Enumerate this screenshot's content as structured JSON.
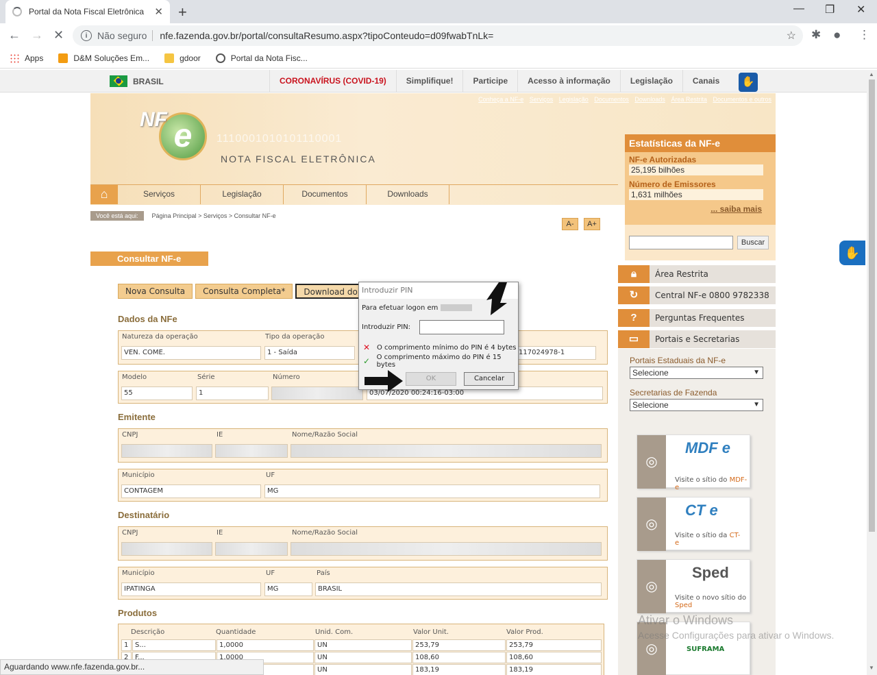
{
  "browser": {
    "tab_title": "Portal da Nota Fiscal Eletrônica",
    "not_secure": "Não seguro",
    "url": "nfe.fazenda.gov.br/portal/consultaResumo.aspx?tipoConteudo=d09fwabTnLk=",
    "bookmarks": [
      "Apps",
      "D&M Soluções Em...",
      "gdoor",
      "Portal da Nota Fisc..."
    ],
    "status": "Aguardando www.nfe.fazenda.gov.br..."
  },
  "govbar": {
    "brasil": "BRASIL",
    "links": [
      "CORONAVÍRUS (COVID-19)",
      "Simplifique!",
      "Participe",
      "Acesso à informação",
      "Legislação",
      "Canais"
    ]
  },
  "site": {
    "toplinks": [
      "Conheça a NF-e",
      "Serviços",
      "Legislação",
      "Documentos",
      "Downloads",
      "Área Restrita",
      "Documentos e outros"
    ],
    "logo_text": "NF",
    "logo_e": "e",
    "binary": "1110001010101110001",
    "tagline": "NOTA FISCAL ELETRÔNICA",
    "nav": [
      "Serviços",
      "Legislação",
      "Documentos",
      "Downloads"
    ],
    "breadcrumb_here": "Você está aqui:",
    "breadcrumb": "Página Principal > Serviços > Consultar NF-e",
    "font_minus": "A-",
    "font_plus": "A+",
    "section_title": "Consultar NF-e",
    "buttons": [
      "Nova Consulta",
      "Consulta Completa*",
      "Download do do"
    ]
  },
  "dados": {
    "heading": "Dados da NFe",
    "natureza_label": "Natureza da operação",
    "natureza": "VEN. COME.",
    "tipo_label": "Tipo da operação",
    "tipo": "1 - Saída",
    "extra": "117024978-1",
    "modelo_label": "Modelo",
    "modelo": "55",
    "serie_label": "Série",
    "serie": "1",
    "numero_label": "Número",
    "data": "03/07/2020 00:24:16-03:00"
  },
  "emitente": {
    "heading": "Emitente",
    "cnpj_label": "CNPJ",
    "ie_label": "IE",
    "nome_label": "Nome/Razão Social",
    "municipio_label": "Município",
    "municipio": "CONTAGEM",
    "uf_label": "UF",
    "uf": "MG"
  },
  "destinatario": {
    "heading": "Destinatário",
    "cnpj_label": "CNPJ",
    "ie_label": "IE",
    "nome_label": "Nome/Razão Social",
    "municipio_label": "Município",
    "municipio": "IPATINGA",
    "uf_label": "UF",
    "uf": "MG",
    "pais_label": "País",
    "pais": "BRASIL"
  },
  "produtos": {
    "heading": "Produtos",
    "headers": [
      "Descrição",
      "Quantidade",
      "Unid. Com.",
      "Valor Unit.",
      "Valor Prod."
    ],
    "rows": [
      {
        "n": "1",
        "desc": "S...",
        "qtd": "1,0000",
        "un": "UN",
        "unit": "253,79",
        "prod": "253,79"
      },
      {
        "n": "2",
        "desc": "F...",
        "qtd": "1,0000",
        "un": "UN",
        "unit": "108,60",
        "prod": "108,60"
      },
      {
        "n": "",
        "desc": "",
        "qtd": "",
        "un": "UN",
        "unit": "183,19",
        "prod": "183,19"
      }
    ]
  },
  "sidebar": {
    "stats_title": "Estatísticas da NF-e",
    "autorizadas_label": "NF-e Autorizadas",
    "autorizadas": "25,195 bilhões",
    "emissores_label": "Número de Emissores",
    "emissores": "1,631 milhões",
    "saiba_mais": "... saiba mais",
    "search_button": "Buscar",
    "links": [
      "Área Restrita",
      "Central NF-e 0800 9782338",
      "Perguntas Frequentes",
      "Portais e Secretarias"
    ],
    "portais_label": "Portais Estaduais da NF-e",
    "portais_value": "Selecione",
    "secretarias_label": "Secretarias de Fazenda",
    "secretarias_value": "Selecione",
    "cards": [
      {
        "logo": "MDF e",
        "visit": "Visite o sítio do",
        "name": "MDF-e"
      },
      {
        "logo": "CT e",
        "visit": "Visite o sítio da",
        "name": "CT-e"
      },
      {
        "logo": "Sped",
        "visit": "Visite o novo sítio do",
        "name": "Sped"
      }
    ],
    "suframa": "SUFRAMA"
  },
  "dialog": {
    "title": "Introduzir PIN",
    "logon": "Para efetuar logon em",
    "pin_label": "Introduzir PIN:",
    "min_msg": "O comprimento mínimo do PIN é 4 bytes",
    "max_msg": "O comprimento máximo do PIN é 15 bytes",
    "ok": "OK",
    "cancel": "Cancelar"
  },
  "windows": {
    "activate": "Ativar o Windows",
    "activate_sub": "Acesse Configurações para ativar o Windows."
  }
}
